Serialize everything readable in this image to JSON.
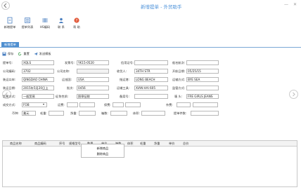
{
  "window": {
    "title": "新增提单 - 外贸助手",
    "min": "—",
    "close": "✕"
  },
  "toolbar": [
    {
      "label": "新增提单",
      "icon": "new-document-icon"
    },
    {
      "label": "提单列表",
      "icon": "list-icon"
    },
    {
      "label": "HS编码",
      "icon": "barcode-icon"
    },
    {
      "label": "联 系",
      "icon": "contact-icon"
    },
    {
      "label": "帮 助",
      "icon": "help-icon"
    }
  ],
  "tabs": [
    "新增提单"
  ],
  "actions": [
    {
      "label": "保存",
      "icon": "save-icon"
    },
    {
      "label": "重置",
      "icon": "reset-icon"
    },
    {
      "label": "发送模板",
      "icon": "send-icon"
    }
  ],
  "form": {
    "bill_no": {
      "label": "提单号:",
      "value": "XQLS"
    },
    "contract": {
      "label": "发票号:",
      "value": "YK15-0520"
    },
    "credit": {
      "label": "信用证号:",
      "value": ""
    },
    "ship_name": {
      "label": "船名航次:",
      "value": ""
    },
    "company_code": {
      "label": "公司编码:",
      "value": "3702"
    },
    "company_name": {
      "label": "公司名称:",
      "value": ""
    },
    "consignee": {
      "label": "收货人:",
      "value": "34TH STR"
    },
    "date": {
      "label": "开航日期:",
      "value": "05/25/15"
    },
    "port_load": {
      "label": "装运口岸:",
      "value": "QINGDAO CHINA"
    },
    "country": {
      "label": "运抵国:",
      "value": "USA"
    },
    "port_dest": {
      "label": "指运港:",
      "value": "LONG BEACH"
    },
    "transport": {
      "label": "运输方式:",
      "value": "BYE SEA"
    },
    "ship_date": {
      "label": "装运日期:",
      "value": "2015年5月20日上"
    },
    "quantity": {
      "label": "批次:",
      "value": "0456"
    },
    "vessel": {
      "label": "运输工具:",
      "value": "XIAN HAI 605"
    },
    "supervise": {
      "label": "监管方式:",
      "value": ""
    },
    "trade_mode": {
      "label": "贸易方式:",
      "value": "一般贸易"
    },
    "tax_nature": {
      "label": "征免性质:",
      "value": "照章征税"
    },
    "nature": {
      "label": "备案号:",
      "value": ""
    },
    "mark": {
      "label": "唛    头:",
      "value": "FRE GIRLS JEANS"
    },
    "deal": {
      "label": "成交方式:",
      "value": "FOB"
    },
    "freight": {
      "label": "运费:",
      "value": ""
    },
    "insurance": {
      "label": "保费:",
      "value": ""
    },
    "misc": {
      "label": "杂费:",
      "value": ""
    },
    "currency": {
      "label": "币种:",
      "value": "美元"
    },
    "gross": {
      "label": "毛重:",
      "value": ""
    },
    "net": {
      "label": "净重:",
      "value": ""
    },
    "pieces": {
      "label": "箱数:",
      "value": ""
    },
    "volume": {
      "label": "体积:",
      "value": ""
    },
    "unit": {
      "label": "提单件数:",
      "value": ""
    }
  },
  "grid": {
    "columns": [
      "商品名称",
      "商品编码",
      "序号",
      "规格型号",
      "数量",
      "单位",
      "箱数",
      "体积",
      "毛重",
      "净重",
      "单价",
      "总价"
    ]
  },
  "context_menu": [
    "新增商品",
    "删除商品"
  ]
}
